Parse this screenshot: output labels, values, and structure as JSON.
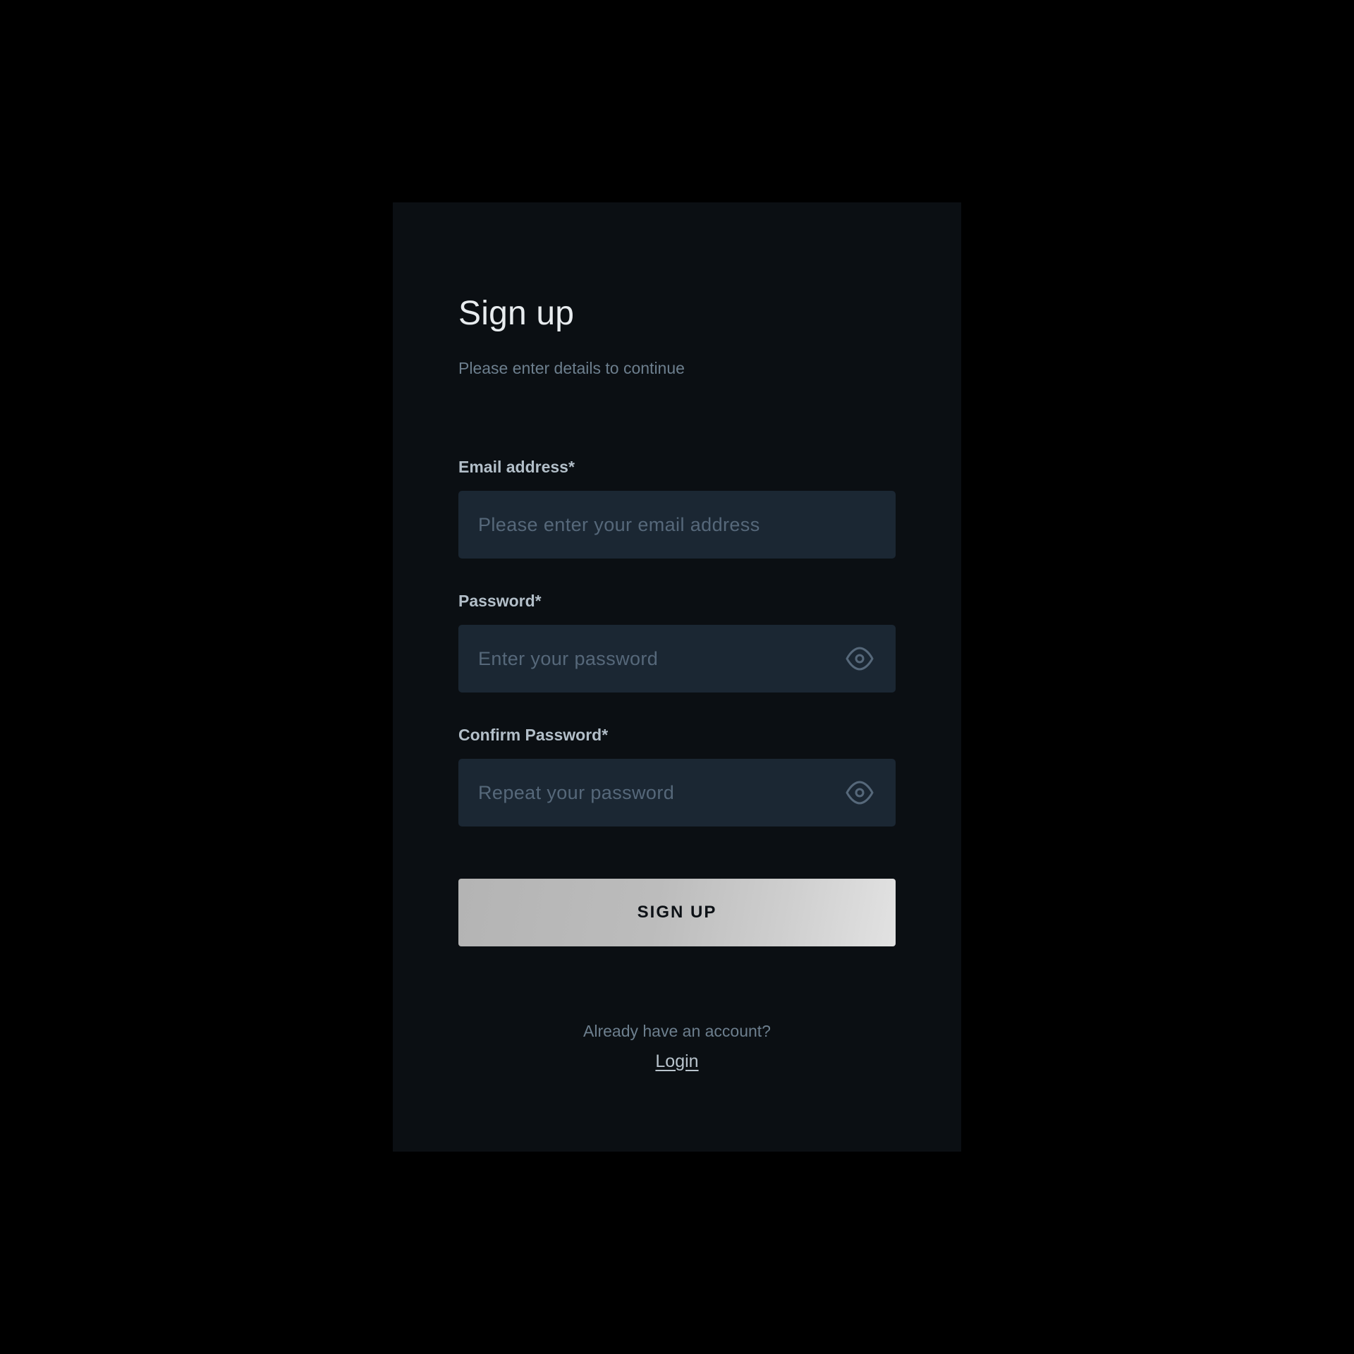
{
  "header": {
    "title": "Sign up",
    "subtitle": "Please enter details to continue"
  },
  "form": {
    "email": {
      "label": "Email address*",
      "placeholder": "Please enter your email address",
      "value": ""
    },
    "password": {
      "label": "Password*",
      "placeholder": "Enter your password",
      "value": "",
      "toggle_icon": "eye-icon"
    },
    "confirm_password": {
      "label": "Confirm Password*",
      "placeholder": "Repeat your password",
      "value": "",
      "toggle_icon": "eye-icon"
    },
    "submit_label": "SIGN UP"
  },
  "footer": {
    "question": "Already have an account?",
    "login_label": "Login"
  },
  "colors": {
    "page_background": "#000000",
    "card_background": "#0b0f13",
    "input_background": "#1b2733",
    "label_text": "#b3bfc9",
    "muted_text": "#6d7f8e",
    "button_gradient_start": "#b4b4b4",
    "button_gradient_end": "#e2e2e2"
  }
}
